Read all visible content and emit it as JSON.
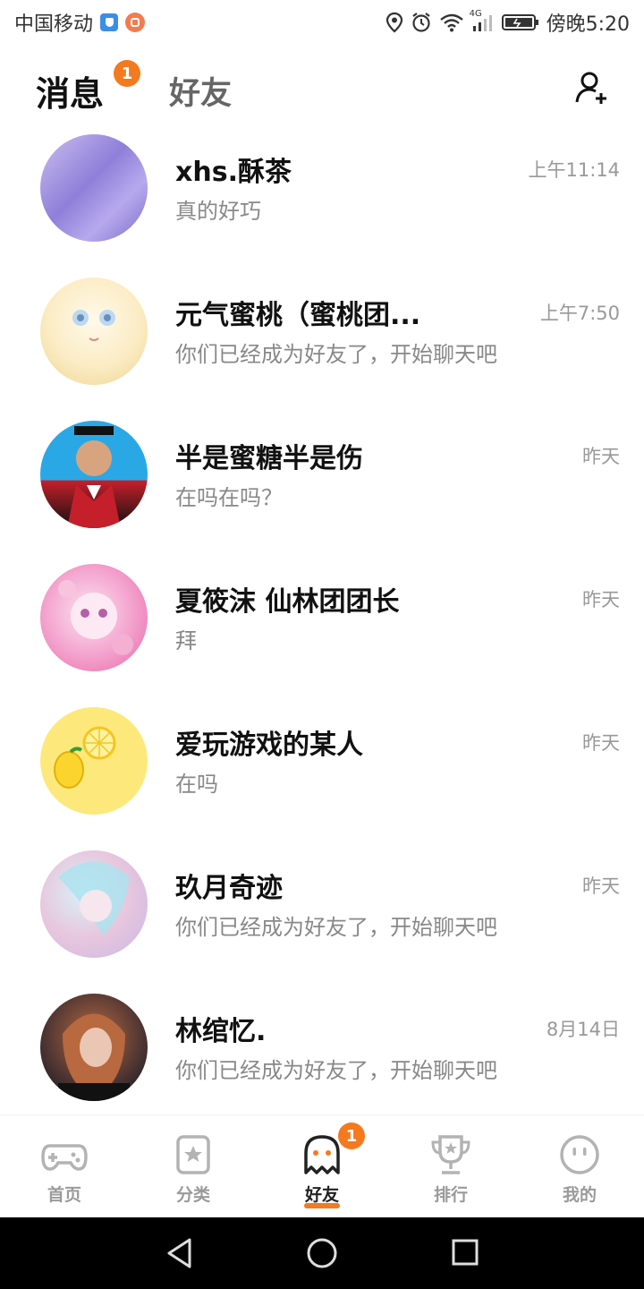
{
  "status_bar": {
    "carrier": "中国移动",
    "network": "4G",
    "time": "傍晚5:20"
  },
  "header": {
    "tab_messages": "消息",
    "tab_messages_badge": "1",
    "tab_friends": "好友"
  },
  "conversations": [
    {
      "name": "xhs.酥茶",
      "preview": "真的好巧",
      "time": "上午11:14"
    },
    {
      "name": "元气蜜桃（蜜桃团...",
      "preview": "你们已经成为好友了，开始聊天吧",
      "time": "上午7:50"
    },
    {
      "name": "半是蜜糖半是伤",
      "preview": "在吗在吗？",
      "time": "昨天"
    },
    {
      "name": "夏筱沫 仙林团团长",
      "preview": "拜",
      "time": "昨天"
    },
    {
      "name": "爱玩游戏的某人",
      "preview": "在吗",
      "time": "昨天"
    },
    {
      "name": "玖月奇迹",
      "preview": "你们已经成为好友了，开始聊天吧",
      "time": "昨天"
    },
    {
      "name": "林绾忆.",
      "preview": "你们已经成为好友了，开始聊天吧",
      "time": "8月14日"
    }
  ],
  "bottom_nav": {
    "items": [
      {
        "label": "首页",
        "icon": "gamepad-icon"
      },
      {
        "label": "分类",
        "icon": "star-bookmark-icon"
      },
      {
        "label": "好友",
        "icon": "ghost-icon",
        "badge": "1",
        "active": true
      },
      {
        "label": "排行",
        "icon": "trophy-icon"
      },
      {
        "label": "我的",
        "icon": "face-icon"
      }
    ]
  },
  "colors": {
    "accent": "#f47a1f",
    "text_primary": "#111111",
    "text_secondary": "#888888"
  }
}
